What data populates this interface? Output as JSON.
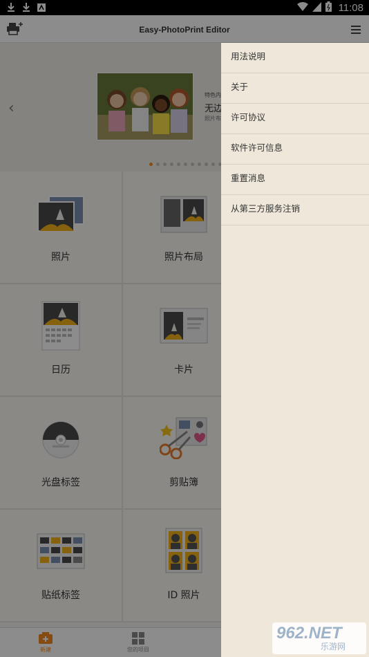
{
  "status_bar": {
    "time": "11:08"
  },
  "app_bar": {
    "title": "Easy-PhotoPrint Editor"
  },
  "banner": {
    "line1": "特色内",
    "line2": "无边",
    "line3": "照片布"
  },
  "grid": [
    {
      "label": "照片",
      "icon": "photo-icon"
    },
    {
      "label": "照片布局",
      "icon": "photo-layout-icon"
    },
    {
      "label": "日历",
      "icon": "calendar-icon"
    },
    {
      "label": "卡片",
      "icon": "card-icon"
    },
    {
      "label": "光盘标签",
      "icon": "disc-label-icon"
    },
    {
      "label": "剪贴簿",
      "icon": "scrapbook-icon"
    },
    {
      "label": "贴纸标签",
      "icon": "sticker-icon"
    },
    {
      "label": "ID 照片",
      "icon": "id-photo-icon"
    }
  ],
  "bottom_nav": {
    "new_label": "新建",
    "recent_label": "您的项目"
  },
  "drawer": {
    "items": [
      "用法说明",
      "关于",
      "许可协议",
      "软件许可信息",
      "重置消息",
      "从第三方服务注销"
    ]
  },
  "watermark": {
    "text1": "962.NET",
    "text2": "乐游网"
  },
  "colors": {
    "accent": "#f08a24",
    "drawer_bg": "#efe7da"
  }
}
